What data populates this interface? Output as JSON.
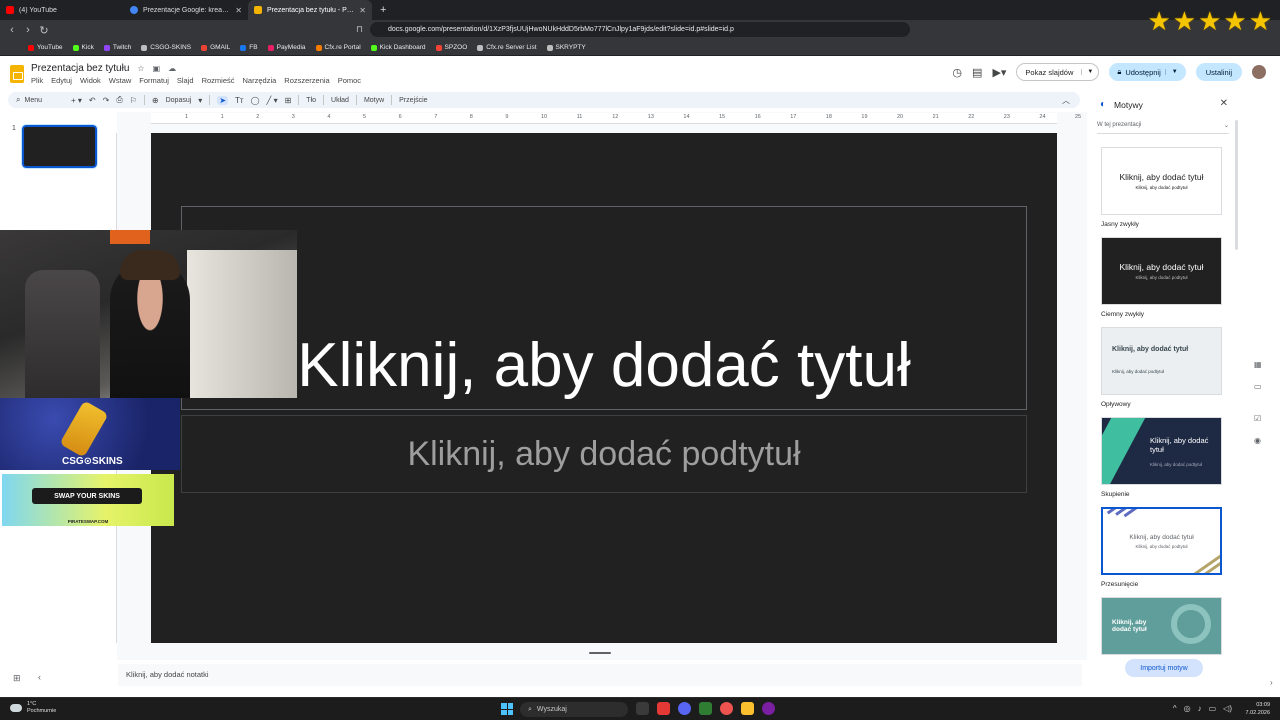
{
  "browser": {
    "tabs": [
      {
        "title": "(4) YouTube",
        "color": "#ff0000"
      },
      {
        "title": "Prezentacje Google: kreator pokazów",
        "color": "#4285f4"
      },
      {
        "title": "Prezentacja bez tytułu - Prezentacje",
        "color": "#f4b400",
        "active": true
      }
    ],
    "new_tab": "+",
    "url": "docs.google.com/presentation/d/1XzP3fjsUUjHwoNUkHddD5rbMo777lCnJlpy1aF9jds/edit?slide=id.p#slide=id.p",
    "bookmarks": [
      {
        "label": "YouTube",
        "color": "#ff0000"
      },
      {
        "label": "Kick",
        "color": "#53fc18"
      },
      {
        "label": "Twitch",
        "color": "#9146ff"
      },
      {
        "label": "CSGO-SKINS",
        "color": "#bdbdbd"
      },
      {
        "label": "GMAIL",
        "color": "#ea4335"
      },
      {
        "label": "FB",
        "color": "#1877f2"
      },
      {
        "label": "PayMedia",
        "color": "#e91e63"
      },
      {
        "label": "Cfx.re Portal",
        "color": "#f57c00"
      },
      {
        "label": "Kick Dashboard",
        "color": "#53fc18"
      },
      {
        "label": "SPZOO",
        "color": "#f44336"
      },
      {
        "label": "Cfx.re Server List",
        "color": "#bdbdbd"
      },
      {
        "label": "SKRYPTY",
        "color": "#bdbdbd"
      }
    ]
  },
  "doc": {
    "title": "Prezentacja bez tytułu",
    "menu": [
      "Plik",
      "Edytuj",
      "Widok",
      "Wstaw",
      "Formatuj",
      "Slajd",
      "Rozmieść",
      "Narzędzia",
      "Rozszerzenia",
      "Pomoc"
    ],
    "slideshow_btn": "Pokaz slajdów",
    "share_btn": "Udostępnij",
    "settings_btn": "Ustalinij"
  },
  "toolbar": {
    "menu_search": "Menu",
    "zoom": "Dopasuj",
    "background": "Tło",
    "layout": "Układ",
    "theme": "Motyw",
    "transition": "Przejście"
  },
  "ruler_numbers": [
    "1",
    "1",
    "2",
    "3",
    "4",
    "5",
    "6",
    "7",
    "8",
    "9",
    "10",
    "11",
    "12",
    "13",
    "14",
    "15",
    "16",
    "17",
    "18",
    "19",
    "20",
    "21",
    "22",
    "23",
    "24",
    "25"
  ],
  "slide": {
    "number": "1",
    "title_placeholder": "Kliknij, aby dodać tytuł",
    "subtitle_placeholder": "Kliknij, aby dodać podtytuł"
  },
  "notes_placeholder": "Kliknij, aby dodać notatki",
  "themes_panel": {
    "title": "Motywy",
    "source": "W tej prezentacji",
    "themes": [
      {
        "name": "Jasny zwykły",
        "preview_title": "Kliknij, aby dodać tytuł",
        "preview_sub": "Kliknij, aby dodać podtytuł"
      },
      {
        "name": "Ciemny zwykły",
        "preview_title": "Kliknij, aby dodać tytuł",
        "preview_sub": "Kliknij, aby dodać podtytuł"
      },
      {
        "name": "Opływowy",
        "preview_title": "Kliknij, aby dodać tytuł",
        "preview_sub": "Kliknij, aby dodać podtytuł"
      },
      {
        "name": "Skupienie",
        "preview_title": "Kliknij, aby dodać tytuł",
        "preview_sub": "Kliknij, aby dodać podtytuł"
      },
      {
        "name": "Przesunięcie",
        "preview_title": "Kliknij, aby dodać tytuł",
        "preview_sub": "Kliknij, aby dodać podtytuł"
      },
      {
        "name": "",
        "preview_title": "Kliknij, aby dodać tytuł",
        "preview_sub": ""
      }
    ],
    "import_btn": "Importuj motyw"
  },
  "overlays": {
    "csg_label": "CSG⊙SKINS",
    "swap_label": "SWAP YOUR SKINS",
    "swap_site": "PIRATESWAP.COM"
  },
  "taskbar": {
    "temp": "1°C",
    "weather": "Pochmurnie",
    "search": "Wyszukaj",
    "time": "03:09",
    "date": "7.02.2026"
  }
}
